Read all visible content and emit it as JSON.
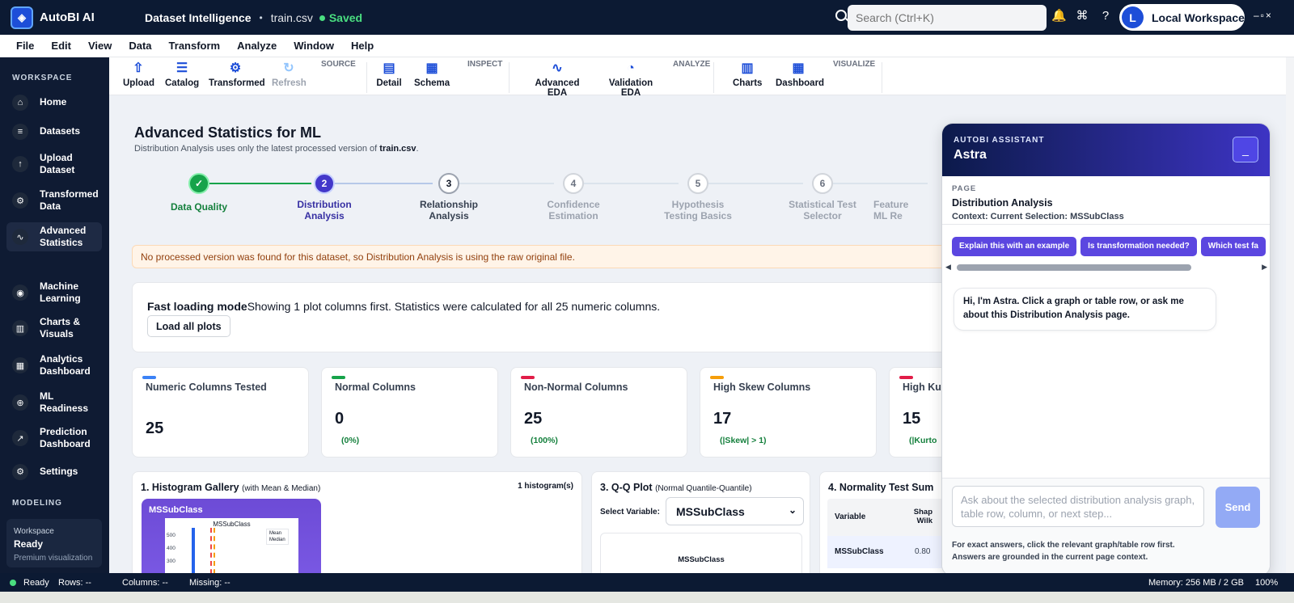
{
  "titlebar": {
    "app": "AutoBI AI",
    "section": "Dataset Intelligence",
    "separator": "•",
    "file": "train.csv",
    "saved": "Saved",
    "search_placeholder": "Search (Ctrl+K)",
    "workspace_initial": "L",
    "workspace": "Local Workspace"
  },
  "menu": [
    "File",
    "Edit",
    "View",
    "Data",
    "Transform",
    "Analyze",
    "Window",
    "Help"
  ],
  "sidebar": {
    "section_workspace": "WORKSPACE",
    "section_modeling": "MODELING",
    "items": [
      {
        "label": "Home",
        "icon": "home-icon"
      },
      {
        "label": "Datasets",
        "icon": "database-icon"
      },
      {
        "label": "Upload Dataset",
        "icon": "upload-icon"
      },
      {
        "label": "Transformed Data",
        "icon": "transform-icon"
      },
      {
        "label": "Advanced Statistics",
        "icon": "pulse-icon"
      },
      {
        "label": "Machine Learning",
        "icon": "brain-icon"
      },
      {
        "label": "Charts & Visuals",
        "icon": "bar-chart-icon"
      },
      {
        "label": "Analytics Dashboard",
        "icon": "dashboard-icon"
      },
      {
        "label": "ML Readiness",
        "icon": "readiness-icon"
      },
      {
        "label": "Prediction Dashboard",
        "icon": "trend-icon"
      },
      {
        "label": "Settings",
        "icon": "settings-icon"
      }
    ],
    "workspace_card": {
      "label": "Workspace",
      "status": "Ready",
      "note": "Premium visualization"
    }
  },
  "ribbon": {
    "groups": {
      "source": "SOURCE",
      "inspect": "INSPECT",
      "analyze": "ANALYZE",
      "visualize": "VISUALIZE"
    },
    "buttons": {
      "upload": "Upload",
      "catalog": "Catalog",
      "transformed": "Transformed",
      "refresh": "Refresh",
      "detail": "Detail",
      "schema": "Schema",
      "advanced_eda": "Advanced EDA",
      "validation_eda": "Validation EDA",
      "charts": "Charts",
      "dashboard": "Dashboard"
    }
  },
  "page": {
    "title": "Advanced Statistics for ML",
    "subtitle_pre": "Distribution Analysis uses only the latest processed version of",
    "subtitle_file": "train.csv",
    "subtitle_post": ".",
    "steps": [
      {
        "num": "✓",
        "label": "Data Quality"
      },
      {
        "num": "2",
        "label": "Distribution Analysis"
      },
      {
        "num": "3",
        "label": "Relationship Analysis"
      },
      {
        "num": "4",
        "label": "Confidence Estimation"
      },
      {
        "num": "5",
        "label": "Hypothesis Testing Basics"
      },
      {
        "num": "6",
        "label": "Statistical Test Selector"
      },
      {
        "label": "Feature ML Re"
      }
    ],
    "notice": "No processed version was found for this dataset, so Distribution Analysis is using the raw original file.",
    "fast": {
      "title": "Fast loading mode",
      "text": "Showing 1 plot columns first. Statistics were calculated for all 25 numeric columns.",
      "button": "Load all plots"
    },
    "cards": [
      {
        "label": "Numeric Columns Tested",
        "value": "25",
        "pct": "",
        "color": "#3b82f6"
      },
      {
        "label": "Normal Columns",
        "value": "0",
        "pct": "(0%)",
        "color": "#16a34a"
      },
      {
        "label": "Non-Normal Columns",
        "value": "25",
        "pct": "(100%)",
        "color": "#e11d48"
      },
      {
        "label": "High Skew Columns",
        "value": "17",
        "pct": "(|Skew| > 1)",
        "color": "#f59e0b"
      },
      {
        "label": "High Ku",
        "value": "15",
        "pct": "(|Kurto",
        "color": "#e11d48"
      }
    ],
    "hist": {
      "title": "1. Histogram Gallery",
      "title_small": "(with Mean & Median)",
      "count": "1 histogram(s)",
      "col": "MSSubClass",
      "plot_title": "MSSubClass",
      "ticks": [
        "500",
        "400",
        "300"
      ],
      "legend": [
        "Mean",
        "Median"
      ]
    },
    "qq": {
      "title": "3. Q-Q Plot",
      "title_small": "(Normal Quantile-Quantile)",
      "select_label": "Select Variable:",
      "selected": "MSSubClass",
      "plot_title": "MSSubClass"
    },
    "norm": {
      "title": "4. Normality Test Sum",
      "col_var": "Variable",
      "col_shap": "Shap Wilk",
      "row_var": "MSSubClass",
      "row_val": "0.80"
    }
  },
  "assistant": {
    "kicker": "AUTOBI ASSISTANT",
    "name": "Astra",
    "page_kicker": "PAGE",
    "page_name": "Distribution Analysis",
    "context": "Context: Current Selection: MSSubClass",
    "chips": [
      "Explain this with an example",
      "Is transformation needed?",
      "Which test fa"
    ],
    "greeting": "Hi, I'm Astra. Click a graph or table row, or ask me about this Distribution Analysis page.",
    "input_placeholder": "Ask about the selected distribution analysis graph, table row, column, or next step...",
    "send": "Send",
    "hint1": "For exact answers, click the relevant graph/table row first.",
    "hint2": "Answers are grounded in the current page context."
  },
  "status": {
    "ready": "Ready",
    "rows": "Rows: --",
    "columns": "Columns: --",
    "missing": "Missing: --",
    "memory": "Memory: 256 MB / 2 GB",
    "zoom": "100%"
  }
}
